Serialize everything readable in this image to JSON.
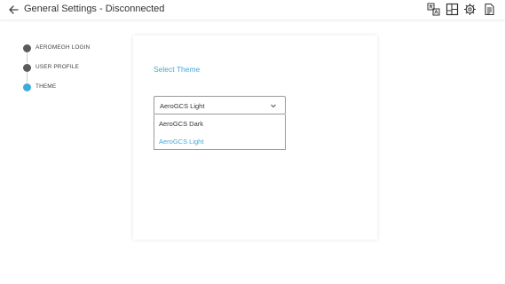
{
  "header": {
    "title": "General Settings - Disconnected",
    "icons": [
      "back-arrow-icon",
      "translate-icon",
      "layout-icon",
      "settings-gear-icon",
      "document-icon"
    ]
  },
  "steps": [
    {
      "label": "AEROMEGH LOGIN",
      "state": "done"
    },
    {
      "label": "USER PROFILE",
      "state": "done"
    },
    {
      "label": "THEME",
      "state": "active"
    }
  ],
  "theme": {
    "heading": "Select Theme",
    "selected": "AeroGCS Light",
    "options": [
      "AeroGCS Dark",
      "AeroGCS Light"
    ]
  },
  "colors": {
    "accent": "#3fa9db",
    "step_done": "#5b5b5b"
  }
}
